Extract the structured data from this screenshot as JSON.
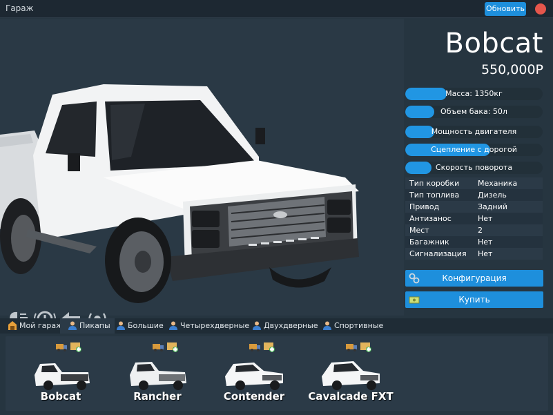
{
  "window": {
    "title": "Гараж",
    "refresh_label": "Обновить"
  },
  "car": {
    "name": "Bobcat",
    "price": "550,000Р"
  },
  "stats": [
    {
      "label": "Масса: 1350кг",
      "level": 0.3
    },
    {
      "label": "Объем бака: 50л",
      "level": 0.21
    },
    {
      "label": "Мощность двигателя",
      "level": 0.21
    },
    {
      "label": "Сцепление с дорогой",
      "level": 0.62
    },
    {
      "label": "Скорость поворота",
      "level": 0.19
    }
  ],
  "specs": [
    {
      "key": "Тип коробки",
      "value": "Механика"
    },
    {
      "key": "Тип топлива",
      "value": "Дизель"
    },
    {
      "key": "Привод",
      "value": "Задний"
    },
    {
      "key": "Антизанос",
      "value": "Нет"
    },
    {
      "key": "Мест",
      "value": "2"
    },
    {
      "key": "Багажник",
      "value": "Нет"
    },
    {
      "key": "Сигнализация",
      "value": "Нет"
    }
  ],
  "buttons": {
    "config": "Конфигурация",
    "buy": "Купить"
  },
  "action_icons": [
    "headlight-icon",
    "warning-icon",
    "arrow-left-icon",
    "signal-icon"
  ],
  "tabs": [
    {
      "label": "Мой гараж",
      "icon": "garage-icon"
    },
    {
      "label": "Пикапы",
      "icon": "user-icon"
    },
    {
      "label": "Большие",
      "icon": "user-icon"
    },
    {
      "label": "Четырехдверные",
      "icon": "user-icon"
    },
    {
      "label": "Двухдверные",
      "icon": "user-icon"
    },
    {
      "label": "Спортивные",
      "icon": "user-icon"
    }
  ],
  "cars": [
    {
      "name": "Bobcat"
    },
    {
      "name": "Rancher"
    },
    {
      "name": "Contender"
    },
    {
      "name": "Cavalcade FXT"
    }
  ],
  "colors": {
    "accent": "#1e8fdc",
    "background": "#263540",
    "close": "#e5564c"
  }
}
